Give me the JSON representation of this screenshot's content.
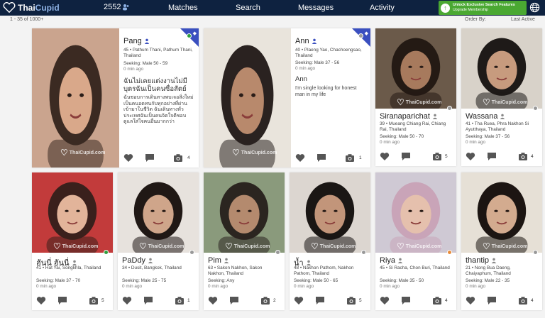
{
  "colors": {
    "nav_bg": "#0e2240",
    "upgrade_green": "#4aa832",
    "badge_blue": "#3a4fbf",
    "online": "#2e9e3c",
    "offline": "#999999",
    "away": "#e98c3a"
  },
  "nav": {
    "logo_a": "Thai",
    "logo_b": "Cupid",
    "notification_count": "2552",
    "links": [
      "Matches",
      "Search",
      "Messages",
      "Activity"
    ],
    "upgrade_title": "Unlock Exclusive Search Features",
    "upgrade_sub": "Upgrade Membership",
    "globe_icon": "globe-icon"
  },
  "results": {
    "count": "1 - 35 of 1000+",
    "order_label": "Order By:",
    "order_value": "Last Active"
  },
  "watermark": "ThaiCupid.com",
  "profiles": [
    {
      "name": "Pang",
      "info": "45 • Pathum Thani, Pathum Thani, Thailand",
      "seeking": "Seeking: Male 50 - 59",
      "ago": "0 min ago",
      "bio_title": "ฉันไม่เคยแต่งงานไม่มีบุตรฉันเป็นคนซื่อสัตย์",
      "bio": "ฉันชอบการเดินทางพบเจอสิ่งใหม่เป็นคนอดทนกับทุกอย่างที่ผ่านเข้ามาในชีวิต ฉันเดินทางทั่วประเทศฉันเป็นคนจิตใจดีชอบดูแลใส่ใจคนอื่นมากกว่า",
      "photos": "4",
      "status": "online",
      "featured": true
    },
    {
      "name": "Ann",
      "info": "40 • Plaeng Yao, Chachoengsao, Thailand",
      "seeking": "Seeking: Male 37 - 56",
      "ago": "0 min ago",
      "bio_title": "Ann",
      "bio": "I'm single looking for honest man in my life",
      "photos": "1",
      "status": "offline",
      "featured": true
    },
    {
      "name": "Siranaparichat",
      "info": "39 • Mueang Chiang Rai, Chiang Rai, Thailand",
      "seeking": "Seeking: Male 50 - 70",
      "ago": "0 min ago",
      "photos": "5",
      "status": "offline"
    },
    {
      "name": "Wassana",
      "info": "41 • Tha Ruea, Phra Nakhon Si Ayutthaya, Thailand",
      "seeking": "Seeking: Male 37 - 56",
      "ago": "0 min ago",
      "photos": "4",
      "status": "offline"
    },
    {
      "name": "ฮันนี่ ฮันนี่",
      "info": "41 • Hat Yai, Songkhla, Thailand",
      "seeking": "Seeking: Male 37 - 70",
      "ago": "0 min ago",
      "photos": "5",
      "status": "online"
    },
    {
      "name": "PaDdy",
      "info": "34 • Dusit, Bangkok, Thailand",
      "seeking": "Seeking: Male 25 - 75",
      "ago": "0 min ago",
      "photos": "1",
      "status": "offline"
    },
    {
      "name": "Pim",
      "info": "63 • Sakon Nakhon, Sakon Nakhon, Thailand",
      "seeking": "Seeking: Any",
      "ago": "0 min ago",
      "photos": "2",
      "status": "offline"
    },
    {
      "name": "น้ำ",
      "info": "48 • Nakhon Pathom, Nakhon Pathom, Thailand",
      "seeking": "Seeking: Male 50 - 65",
      "ago": "0 min ago",
      "photos": "5",
      "status": "offline"
    },
    {
      "name": "Riya",
      "info": "45 • Si Racha, Chon Buri, Thailand",
      "seeking": "Seeking: Male 35 - 50",
      "ago": "0 min ago",
      "photos": "4",
      "status": "away"
    },
    {
      "name": "thantip",
      "info": "21 • Nong Bua Daeng, Chaiyaphum, Thailand",
      "seeking": "Seeking: Male 22 - 35",
      "ago": "0 min ago",
      "photos": "4",
      "status": "offline"
    }
  ]
}
